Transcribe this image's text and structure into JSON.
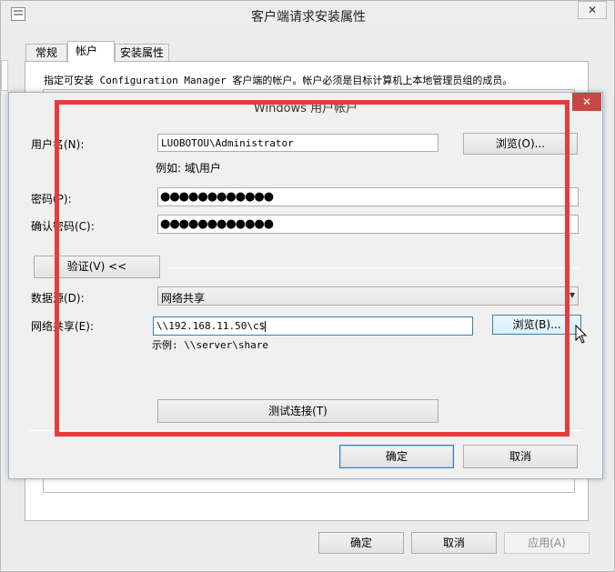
{
  "parent": {
    "title": "客户端请求安装属性",
    "tabs": [
      "常规",
      "帐户",
      "安装属性"
    ],
    "description": "指定可安装 Configuration Manager 客户端的帐户。帐户必须是目标计算机上本地管理员组的成员。",
    "buttons": {
      "ok": "确定",
      "cancel": "取消",
      "apply": "应用(A)"
    }
  },
  "dialog": {
    "title": "Windows 用户帐户",
    "close": "✕",
    "username_label": "用户名(N):",
    "username_value": "LUOBOTOU\\Administrator",
    "browse1": "浏览(O)...",
    "example": "例如: 域\\用户",
    "password_label": "密码(P):",
    "password_value": "●●●●●●●●●●●●",
    "confirm_label": "确认密码(C):",
    "confirm_value": "●●●●●●●●●●●●",
    "verify_button": "验证(V) <<",
    "datasource_label": "数据源(D):",
    "datasource_value": "网络共享",
    "share_label": "网络共享(E):",
    "share_value": "\\\\192.168.11.50\\c$",
    "browse2": "浏览(B)...",
    "share_example": "示例: \\\\server\\share",
    "test_button": "测试连接(T)",
    "ok": "确定",
    "cancel": "取消"
  },
  "colors": {
    "highlight": "#ea3a3d",
    "close_red": "#c74747",
    "accent_blue": "#3c7fb1"
  }
}
